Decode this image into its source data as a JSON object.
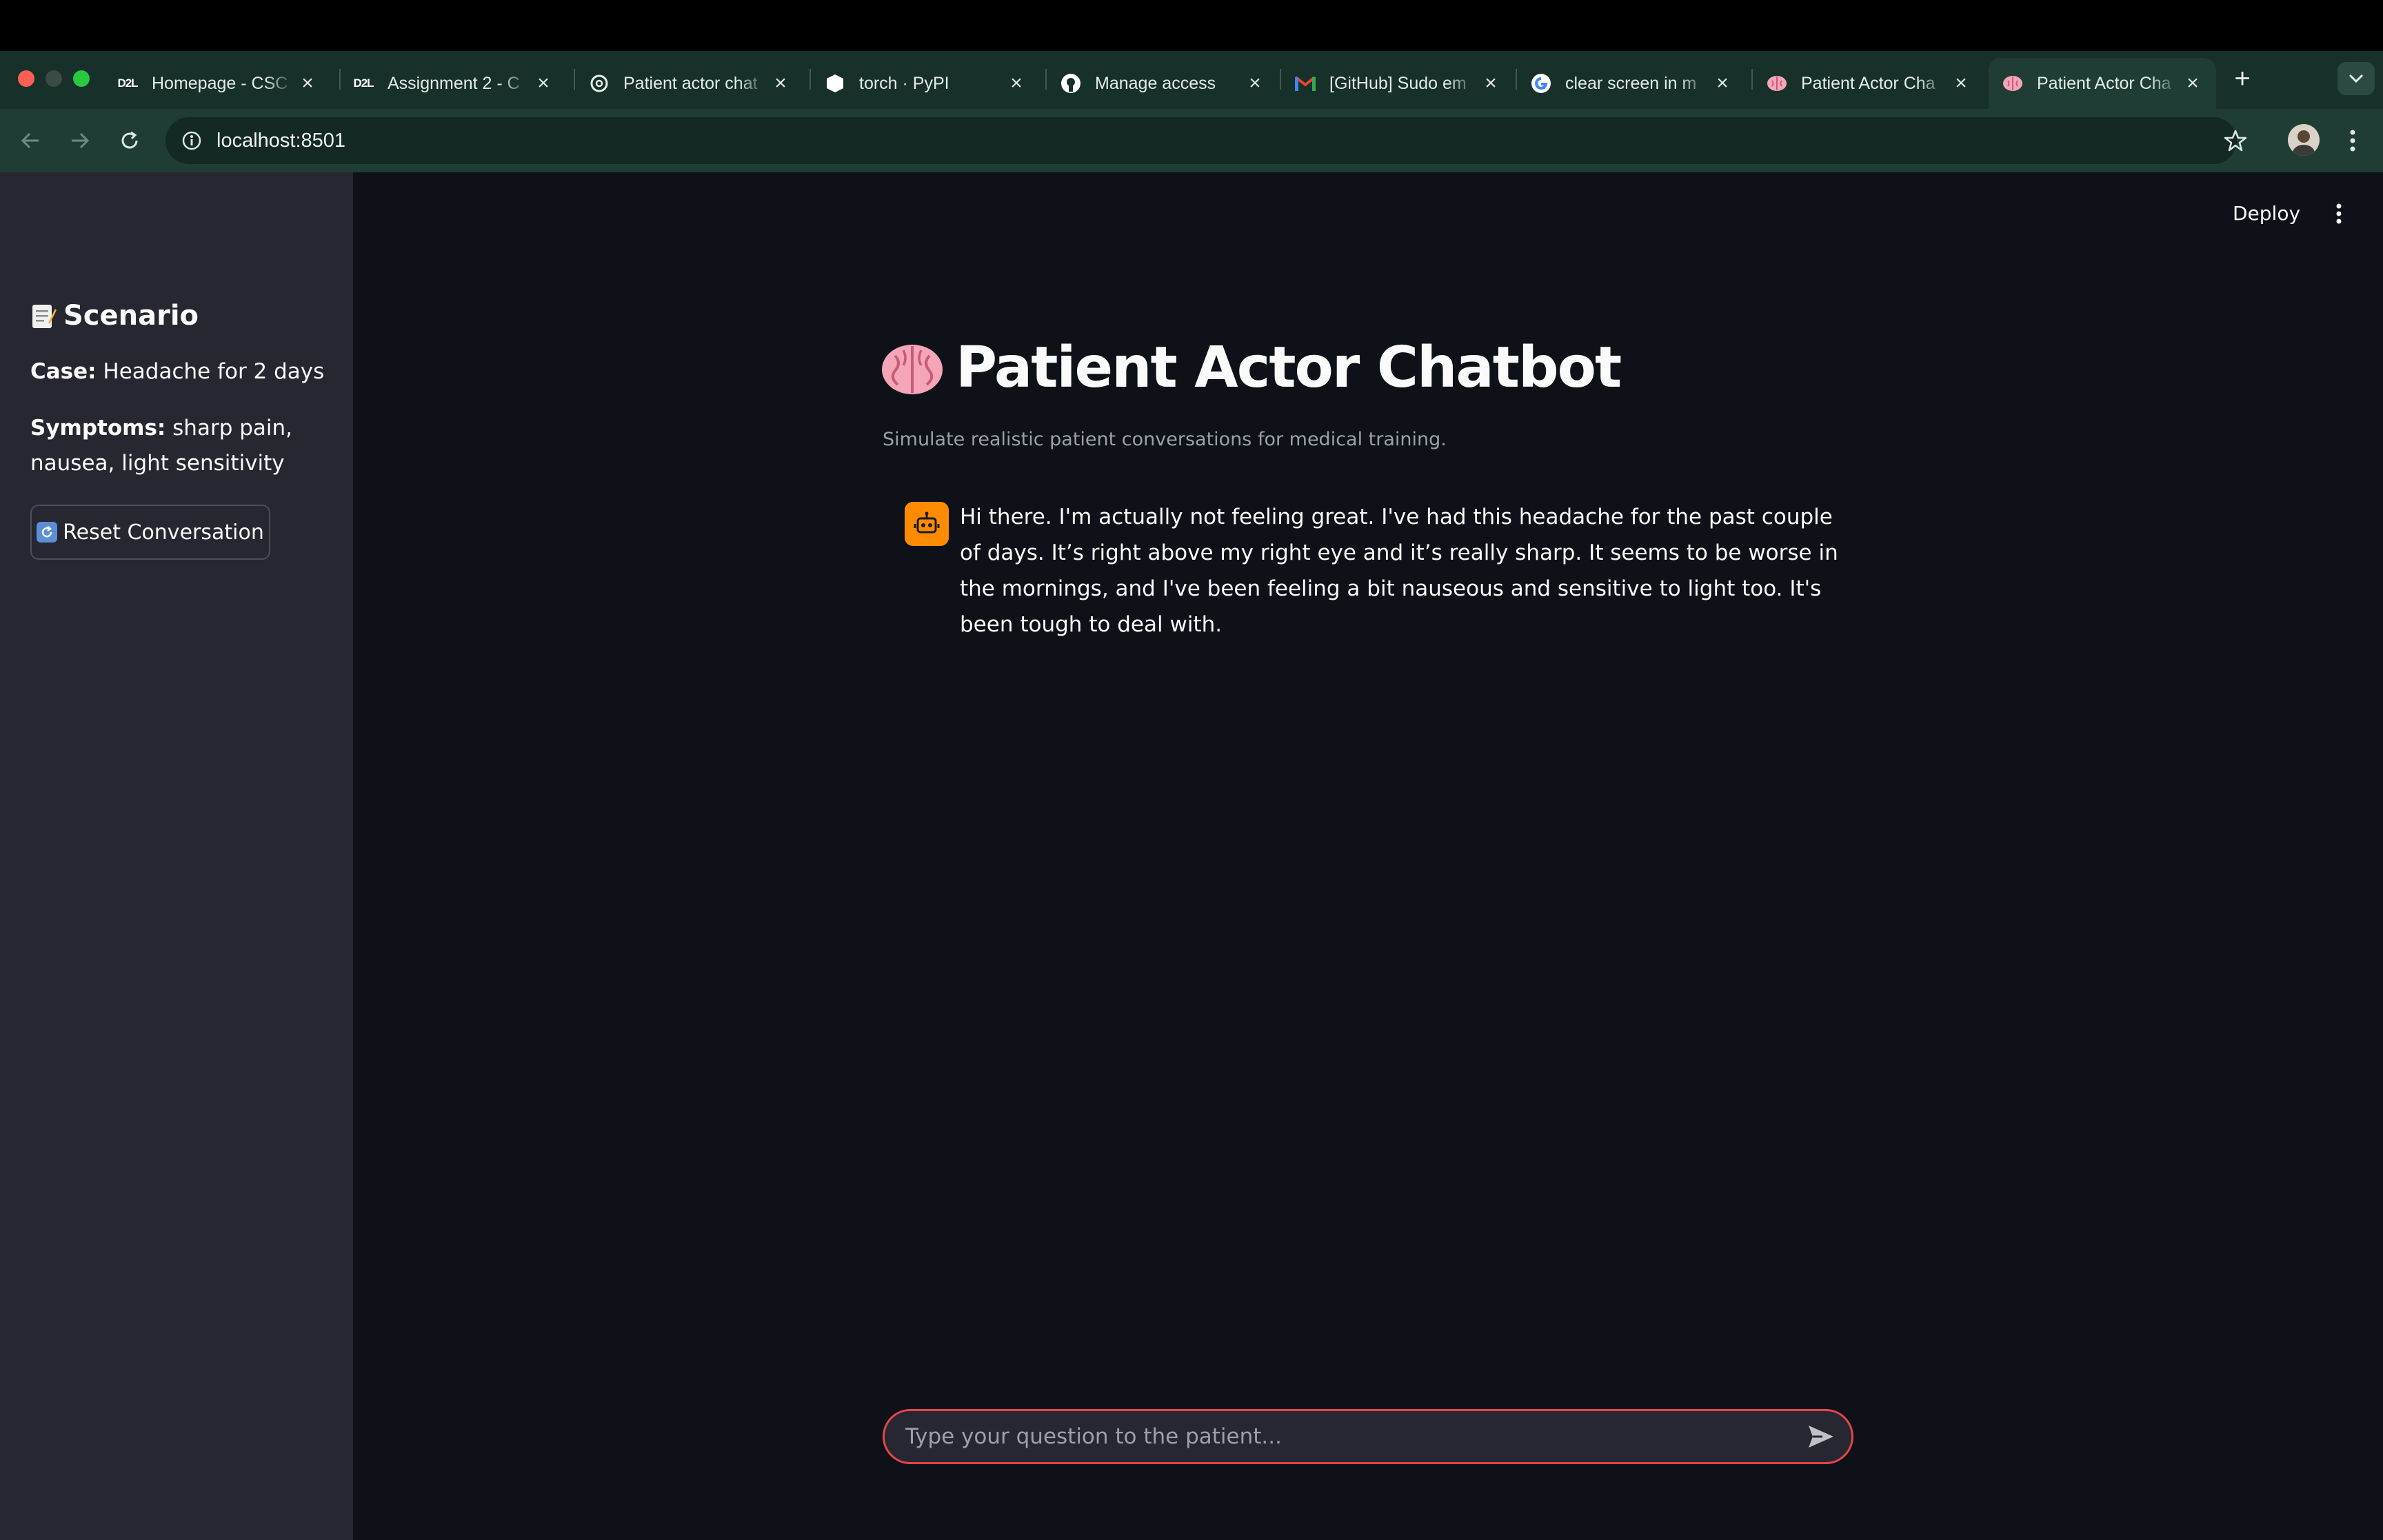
{
  "browser": {
    "tabs": [
      {
        "title": "Homepage - CSC",
        "icon": "d2l-icon"
      },
      {
        "title": "Assignment 2 - C",
        "icon": "d2l-icon"
      },
      {
        "title": "Patient actor chat",
        "icon": "openai-icon"
      },
      {
        "title": "torch · PyPI",
        "icon": "pypi-icon"
      },
      {
        "title": "Manage access",
        "icon": "github-icon"
      },
      {
        "title": "[GitHub] Sudo em",
        "icon": "gmail-icon"
      },
      {
        "title": "clear screen in m",
        "icon": "google-icon"
      },
      {
        "title": "Patient Actor Cha",
        "icon": "brain-icon"
      },
      {
        "title": "Patient Actor Cha",
        "icon": "brain-icon"
      }
    ],
    "d2l_badge": "D2L",
    "url": "localhost:8501",
    "colors": {
      "chrome": "#1f3d35",
      "tabstrip": "#17302a"
    }
  },
  "sidebar": {
    "heading": "Scenario",
    "case_label": "Case:",
    "case_value": "Headache for 2 days",
    "symptoms_label": "Symptoms:",
    "symptoms_value": "sharp pain, nausea, light sensitivity",
    "reset_button": "Reset Conversation"
  },
  "header": {
    "deploy": "Deploy"
  },
  "main": {
    "title": "Patient Actor Chatbot",
    "caption": "Simulate realistic patient conversations for medical training.",
    "messages": [
      {
        "role": "assistant",
        "text": "Hi there. I'm actually not feeling great. I've had this headache for the past couple of days. It’s right above my right eye and it’s really sharp. It seems to be worse in the mornings, and I've been feeling a bit nauseous and sensitive to light too. It's been tough to deal with."
      }
    ],
    "input_placeholder": "Type your question to the patient...",
    "colors": {
      "avatar": "#ff8c00",
      "input_border": "#e9434c",
      "background": "#0e1117",
      "sidebar": "#262730"
    }
  }
}
